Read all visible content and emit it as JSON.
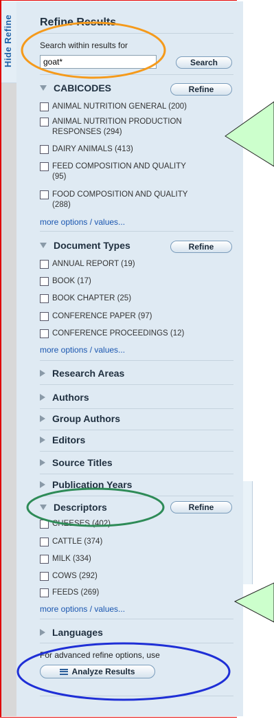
{
  "hide_refine": "Hide Refine",
  "title": "Refine Results",
  "search": {
    "label": "Search within results for",
    "value": "goat*",
    "button": "Search"
  },
  "cabicodes": {
    "header": "CABICODES",
    "refine": "Refine",
    "options": [
      {
        "line1": "ANIMAL NUTRITION GENERAL (200)",
        "line2": ""
      },
      {
        "line1": "ANIMAL NUTRITION PRODUCTION",
        "line2": "RESPONSES (294)"
      },
      {
        "line1": "DAIRY ANIMALS (413)",
        "line2": ""
      },
      {
        "line1": "FEED COMPOSITION AND QUALITY",
        "line2": "(95)"
      },
      {
        "line1": "FOOD COMPOSITION AND QUALITY",
        "line2": "(288)"
      }
    ],
    "more": "more options / values..."
  },
  "document_types": {
    "header": "Document Types",
    "refine": "Refine",
    "options": [
      "ANNUAL REPORT (19)",
      "BOOK (17)",
      "BOOK CHAPTER (25)",
      "CONFERENCE PAPER (97)",
      "CONFERENCE PROCEEDINGS (12)"
    ],
    "more": "more options / values..."
  },
  "collapsed_sections": [
    "Research Areas",
    "Authors",
    "Group Authors",
    "Editors",
    "Source Titles",
    "Publication Years"
  ],
  "descriptors": {
    "header": "Descriptors",
    "refine": "Refine",
    "options": [
      "CHEESES (402)",
      "CATTLE (374)",
      "MILK (334)",
      "COWS (292)",
      "FEEDS (269)"
    ],
    "more": "more options / values..."
  },
  "languages": "Languages",
  "advanced_note": "For advanced refine options, use",
  "analyze_button": "Analyze Results",
  "colors": {
    "border": "#e00000",
    "panel": "#dfeaf3",
    "link": "#1a56b0",
    "orange": "#f59a1b",
    "green": "#2e8b57",
    "blue": "#1f2fd6",
    "callout": "#ccffcc"
  }
}
